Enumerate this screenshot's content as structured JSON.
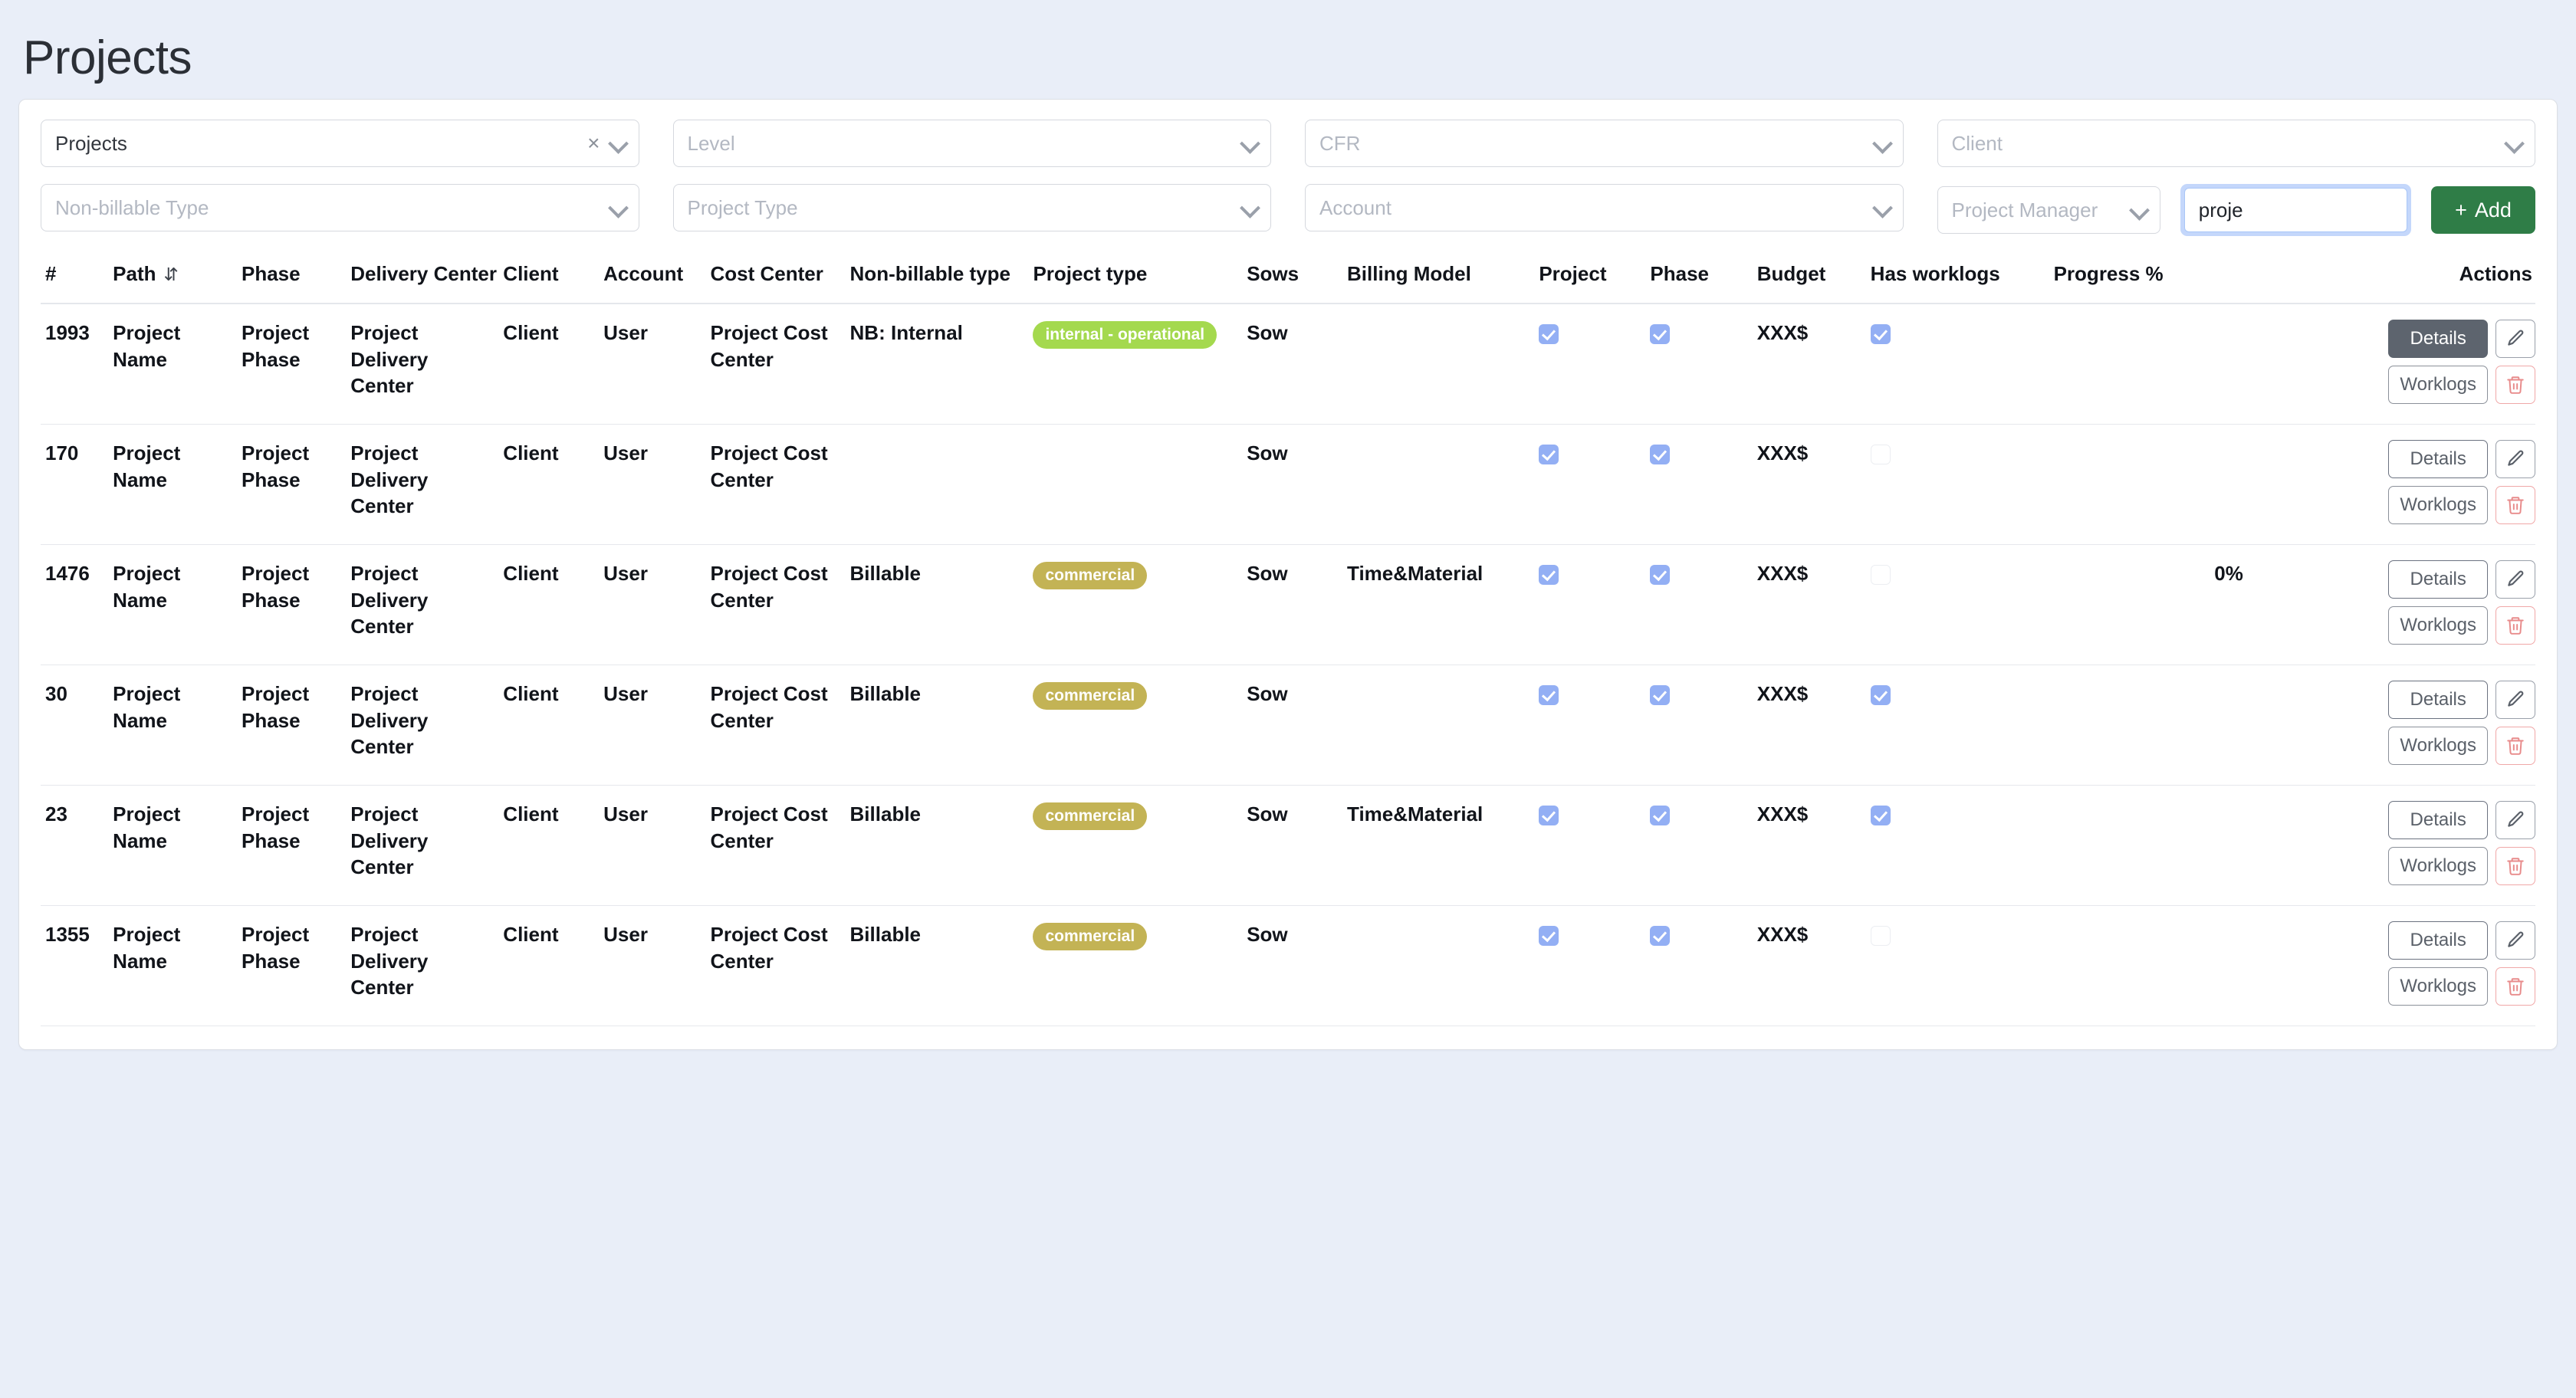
{
  "page": {
    "title": "Projects"
  },
  "filters": {
    "row1": [
      {
        "name": "projects",
        "value": "Projects",
        "placeholder": "Projects",
        "has_value": true,
        "clearable": true
      },
      {
        "name": "level",
        "value": "",
        "placeholder": "Level",
        "has_value": false,
        "clearable": false
      },
      {
        "name": "cfr",
        "value": "",
        "placeholder": "CFR",
        "has_value": false,
        "clearable": false
      },
      {
        "name": "client",
        "value": "",
        "placeholder": "Client",
        "has_value": false,
        "clearable": false
      }
    ],
    "row2": [
      {
        "name": "non-billable-type",
        "value": "",
        "placeholder": "Non-billable Type",
        "has_value": false,
        "clearable": false
      },
      {
        "name": "project-type",
        "value": "",
        "placeholder": "Project Type",
        "has_value": false,
        "clearable": false
      },
      {
        "name": "account",
        "value": "",
        "placeholder": "Account",
        "has_value": false,
        "clearable": false
      },
      {
        "name": "project-manager",
        "value": "",
        "placeholder": "Project Manager",
        "has_value": false,
        "clearable": false
      }
    ],
    "search": {
      "value": "proje",
      "placeholder": ""
    },
    "add_button": {
      "label": "Add",
      "plus": "+",
      "color": "#2f7d47"
    }
  },
  "table": {
    "headers": {
      "id": "#",
      "path": "Path",
      "path_sort_icon": "⇵",
      "phase": "Phase",
      "delivery_center": "Delivery Center",
      "client": "Client",
      "account": "Account",
      "cost_center": "Cost Center",
      "non_billable_type": "Non-billable type",
      "project_type": "Project type",
      "sows": "Sows",
      "billing_model": "Billing Model",
      "project": "Project",
      "phase2": "Phase",
      "budget": "Budget",
      "has_worklogs": "Has worklogs",
      "progress": "Progress %",
      "actions": "Actions"
    },
    "action_labels": {
      "details": "Details",
      "worklogs": "Worklogs"
    },
    "badge_colors": {
      "internal": "#a4d94e",
      "commercial": "#c3b355"
    },
    "checkbox_color": "#93aff4",
    "rows": [
      {
        "id": "1993",
        "path": "Project Name",
        "phase": "Project Phase",
        "delivery_center": "Project Delivery Center",
        "client": "Client",
        "account": "User",
        "cost_center": "Project Cost Center",
        "non_billable_type": "NB: Internal",
        "project_type": "internal - operational",
        "project_type_class": "internal",
        "sows": "Sow",
        "billing_model": "",
        "project_checked": true,
        "phase_checked": true,
        "budget": "XXX$",
        "has_worklogs_checked": true,
        "progress": "",
        "details_active": true
      },
      {
        "id": "170",
        "path": "Project Name",
        "phase": "Project Phase",
        "delivery_center": "Project Delivery Center",
        "client": "Client",
        "account": "User",
        "cost_center": "Project Cost Center",
        "non_billable_type": "",
        "project_type": "",
        "project_type_class": "",
        "sows": "Sow",
        "billing_model": "",
        "project_checked": true,
        "phase_checked": true,
        "budget": "XXX$",
        "has_worklogs_checked": false,
        "progress": "",
        "details_active": false
      },
      {
        "id": "1476",
        "path": "Project Name",
        "phase": "Project Phase",
        "delivery_center": "Project Delivery Center",
        "client": "Client",
        "account": "User",
        "cost_center": "Project Cost Center",
        "non_billable_type": "Billable",
        "project_type": "commercial",
        "project_type_class": "commercial",
        "sows": "Sow",
        "billing_model": "Time&Material",
        "project_checked": true,
        "phase_checked": true,
        "budget": "XXX$",
        "has_worklogs_checked": false,
        "progress": "0%",
        "details_active": false
      },
      {
        "id": "30",
        "path": "Project Name",
        "phase": "Project Phase",
        "delivery_center": "Project Delivery Center",
        "client": "Client",
        "account": "User",
        "cost_center": "Project Cost Center",
        "non_billable_type": "Billable",
        "project_type": "commercial",
        "project_type_class": "commercial",
        "sows": "Sow",
        "billing_model": "",
        "project_checked": true,
        "phase_checked": true,
        "budget": "XXX$",
        "has_worklogs_checked": true,
        "progress": "",
        "details_active": false
      },
      {
        "id": "23",
        "path": "Project Name",
        "phase": "Project Phase",
        "delivery_center": "Project Delivery Center",
        "client": "Client",
        "account": "User",
        "cost_center": "Project Cost Center",
        "non_billable_type": "Billable",
        "project_type": "commercial",
        "project_type_class": "commercial",
        "sows": "Sow",
        "billing_model": "Time&Material",
        "project_checked": true,
        "phase_checked": true,
        "budget": "XXX$",
        "has_worklogs_checked": true,
        "progress": "",
        "details_active": false
      },
      {
        "id": "1355",
        "path": "Project Name",
        "phase": "Project Phase",
        "delivery_center": "Project Delivery Center",
        "client": "Client",
        "account": "User",
        "cost_center": "Project Cost Center",
        "non_billable_type": "Billable",
        "project_type": "commercial",
        "project_type_class": "commercial",
        "sows": "Sow",
        "billing_model": "",
        "project_checked": true,
        "phase_checked": true,
        "budget": "XXX$",
        "has_worklogs_checked": false,
        "progress": "",
        "details_active": false
      }
    ]
  }
}
